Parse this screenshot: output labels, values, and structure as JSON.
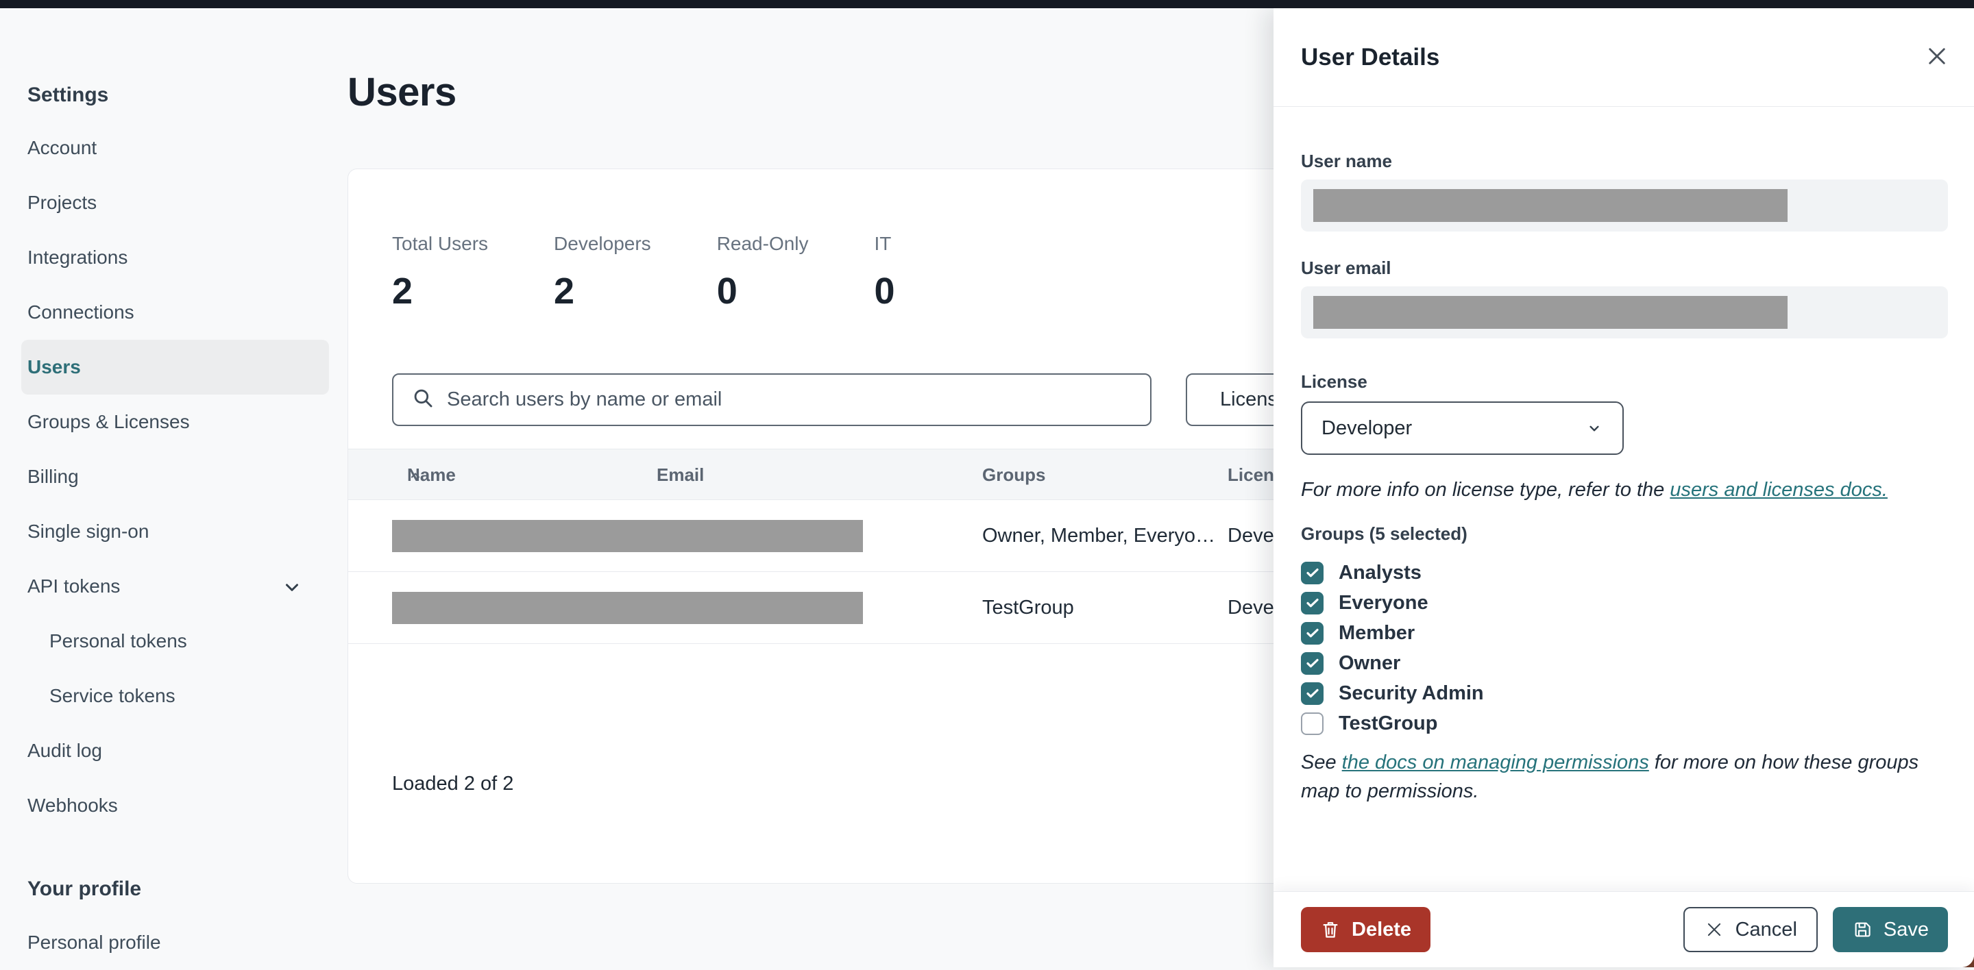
{
  "colors": {
    "accent_teal": "#2E6F78",
    "link_teal": "#26737B",
    "delete_red": "#A93529",
    "topbar_dark": "#151922",
    "redaction_gray": "#9B9B9B"
  },
  "sidebar": {
    "settings_header": "Settings",
    "items": [
      {
        "label": "Account",
        "active": false
      },
      {
        "label": "Projects",
        "active": false
      },
      {
        "label": "Integrations",
        "active": false
      },
      {
        "label": "Connections",
        "active": false
      },
      {
        "label": "Users",
        "active": true
      },
      {
        "label": "Groups & Licenses",
        "active": false
      },
      {
        "label": "Billing",
        "active": false
      },
      {
        "label": "Single sign-on",
        "active": false
      },
      {
        "label": "API tokens",
        "active": false,
        "expandable": true
      },
      {
        "label": "Personal tokens",
        "active": false,
        "child": true
      },
      {
        "label": "Service tokens",
        "active": false,
        "child": true
      },
      {
        "label": "Audit log",
        "active": false
      },
      {
        "label": "Webhooks",
        "active": false
      }
    ],
    "profile_header": "Your profile",
    "profile_items": [
      {
        "label": "Personal profile"
      }
    ]
  },
  "main": {
    "title": "Users",
    "stats": [
      {
        "label": "Total Users",
        "value": "2"
      },
      {
        "label": "Developers",
        "value": "2"
      },
      {
        "label": "Read-Only",
        "value": "0"
      },
      {
        "label": "IT",
        "value": "0"
      }
    ],
    "search_placeholder": "Search users by name or email",
    "filter_button": "License",
    "table": {
      "columns": [
        "Name",
        "Email",
        "Groups",
        "License"
      ],
      "rows": [
        {
          "name_email_redacted": true,
          "groups": "Owner, Member, Everyo…",
          "license": "Developer"
        },
        {
          "name_email_redacted": true,
          "groups": "TestGroup",
          "license": "Developer"
        }
      ],
      "load_status": "Loaded 2 of 2"
    }
  },
  "panel": {
    "title": "User Details",
    "user_name_label": "User name",
    "user_email_label": "User email",
    "license_label": "License",
    "license_value": "Developer",
    "license_note_prefix": "For more info on license type, refer to the ",
    "license_note_link": "users and licenses docs.",
    "groups_label": "Groups (5 selected)",
    "groups": [
      {
        "label": "Analysts",
        "checked": true
      },
      {
        "label": "Everyone",
        "checked": true
      },
      {
        "label": "Member",
        "checked": true
      },
      {
        "label": "Owner",
        "checked": true
      },
      {
        "label": "Security Admin",
        "checked": true
      },
      {
        "label": "TestGroup",
        "checked": false
      }
    ],
    "groups_note_prefix": "See ",
    "groups_note_link": "the docs on managing permissions",
    "groups_note_suffix": " for more on how these groups map to permissions.",
    "footer": {
      "delete": "Delete",
      "cancel": "Cancel",
      "save": "Save"
    }
  }
}
